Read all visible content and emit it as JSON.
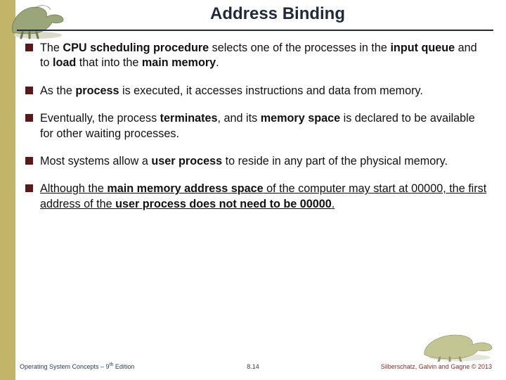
{
  "title": "Address Binding",
  "bullets": [
    {
      "html": "The <b>CPU scheduling procedure</b> selects one of the processes in the <b>input queue</b> and to <b>load</b> that into the <b>main memory</b>."
    },
    {
      "html": "As the <b>process</b> is executed, it accesses instructions and data from memory."
    },
    {
      "html": "Eventually, the process <b>terminates</b>, and its <b>memory space</b> is declared to  be available for other waiting processes."
    },
    {
      "html": "Most systems allow a <b>user process</b> to reside in any part of the physical memory."
    },
    {
      "html": "<span class=\"u\">Although the <b>main memory address space</b> of the computer may start at 00000, the first address of the <b>user process does not need to be 00000</b>.</span>"
    }
  ],
  "footer": {
    "left_prefix": "Operating System Concepts – 9",
    "left_suffix": " Edition",
    "left_sup": "th",
    "center": "8.14",
    "right": "Silberschatz, Galvin and Gagne © 2013"
  },
  "icons": {
    "top_dino": "dinosaur-icon",
    "bottom_dino": "dinosaur-icon"
  }
}
